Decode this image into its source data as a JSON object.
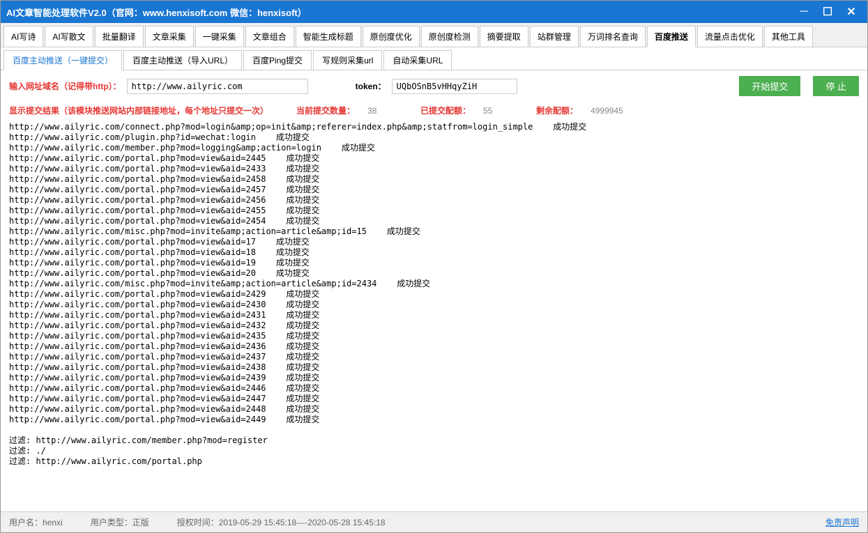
{
  "titlebar": {
    "title": "AI文章智能处理软件V2.0（官网：www.henxisoft.com  微信：henxisoft）"
  },
  "main_tabs": [
    "AI写诗",
    "AI写散文",
    "批量翻译",
    "文章采集",
    "一键采集",
    "文章组合",
    "智能生成标题",
    "原创度优化",
    "原创度检测",
    "摘要提取",
    "站群管理",
    "万词排名查询",
    "百度推送",
    "流量点击优化",
    "其他工具"
  ],
  "main_tab_active": 12,
  "sub_tabs": [
    "百度主动推送（一键提交）",
    "百度主动推送（导入URL）",
    "百度Ping提交",
    "写规则采集url",
    "自动采集URL"
  ],
  "sub_tab_active": 0,
  "input": {
    "url_label": "输入网址域名（记得带http）：",
    "url_value": "http://www.ailyric.com",
    "token_label": "token：",
    "token_value": "UQbOSnB5vHHqyZiH",
    "start_btn": "开始提交",
    "stop_btn": "停 止"
  },
  "stats": {
    "result_label": "显示提交结果（该模块推送网站内部链接地址，每个地址只提交一次）",
    "current_label": "当前提交数量：",
    "current_val": "38",
    "submitted_label": "已提交配额：",
    "submitted_val": "55",
    "remain_label": "剩余配额：",
    "remain_val": "4999945"
  },
  "results": [
    "http://www.ailyric.com/connect.php?mod=login&amp;op=init&amp;referer=index.php&amp;statfrom=login_simple    成功提交",
    "http://www.ailyric.com/plugin.php?id=wechat:login    成功提交",
    "http://www.ailyric.com/member.php?mod=logging&amp;action=login    成功提交",
    "http://www.ailyric.com/portal.php?mod=view&aid=2445    成功提交",
    "http://www.ailyric.com/portal.php?mod=view&aid=2433    成功提交",
    "http://www.ailyric.com/portal.php?mod=view&aid=2458    成功提交",
    "http://www.ailyric.com/portal.php?mod=view&aid=2457    成功提交",
    "http://www.ailyric.com/portal.php?mod=view&aid=2456    成功提交",
    "http://www.ailyric.com/portal.php?mod=view&aid=2455    成功提交",
    "http://www.ailyric.com/portal.php?mod=view&aid=2454    成功提交",
    "http://www.ailyric.com/misc.php?mod=invite&amp;action=article&amp;id=15    成功提交",
    "http://www.ailyric.com/portal.php?mod=view&aid=17    成功提交",
    "http://www.ailyric.com/portal.php?mod=view&aid=18    成功提交",
    "http://www.ailyric.com/portal.php?mod=view&aid=19    成功提交",
    "http://www.ailyric.com/portal.php?mod=view&aid=20    成功提交",
    "http://www.ailyric.com/misc.php?mod=invite&amp;action=article&amp;id=2434    成功提交",
    "http://www.ailyric.com/portal.php?mod=view&aid=2429    成功提交",
    "http://www.ailyric.com/portal.php?mod=view&aid=2430    成功提交",
    "http://www.ailyric.com/portal.php?mod=view&aid=2431    成功提交",
    "http://www.ailyric.com/portal.php?mod=view&aid=2432    成功提交",
    "http://www.ailyric.com/portal.php?mod=view&aid=2435    成功提交",
    "http://www.ailyric.com/portal.php?mod=view&aid=2436    成功提交",
    "http://www.ailyric.com/portal.php?mod=view&aid=2437    成功提交",
    "http://www.ailyric.com/portal.php?mod=view&aid=2438    成功提交",
    "http://www.ailyric.com/portal.php?mod=view&aid=2439    成功提交",
    "http://www.ailyric.com/portal.php?mod=view&aid=2446    成功提交",
    "http://www.ailyric.com/portal.php?mod=view&aid=2447    成功提交",
    "http://www.ailyric.com/portal.php?mod=view&aid=2448    成功提交",
    "http://www.ailyric.com/portal.php?mod=view&aid=2449    成功提交",
    "",
    "过滤: http://www.ailyric.com/member.php?mod=register",
    "过滤: ./",
    "过滤: http://www.ailyric.com/portal.php"
  ],
  "statusbar": {
    "user_label": "用户名：",
    "user_val": "henxi",
    "type_label": "用户类型：",
    "type_val": "正版",
    "auth_label": "授权时间：",
    "auth_val": "2019-05-29 15:45:18----2020-05-28 15:45:18",
    "disclaimer": "免责声明"
  }
}
